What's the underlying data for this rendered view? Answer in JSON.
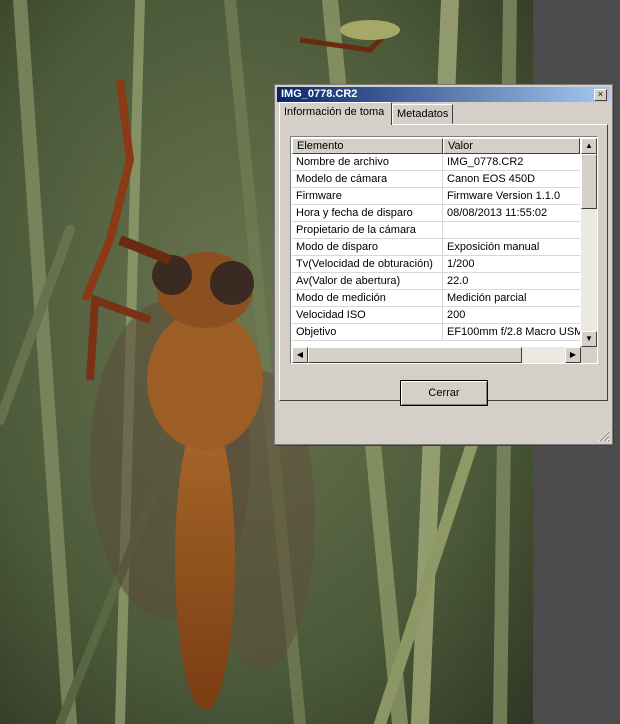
{
  "background": {
    "photo": "macro photograph of an orange robber fly on green pine needles",
    "icon": "robber-fly-photo"
  },
  "dialog": {
    "title": "IMG_0778.CR2",
    "close_glyph": "×",
    "tabs": [
      {
        "label": "Información de toma",
        "active": true
      },
      {
        "label": "Metadatos",
        "active": false
      }
    ],
    "table": {
      "headers": [
        "Elemento",
        "Valor"
      ],
      "rows": [
        {
          "element": "Nombre de archivo",
          "value": "IMG_0778.CR2"
        },
        {
          "element": "Modelo de cámara",
          "value": "Canon EOS 450D"
        },
        {
          "element": "Firmware",
          "value": "Firmware Version 1.1.0"
        },
        {
          "element": "Hora y fecha de disparo",
          "value": "08/08/2013 11:55:02"
        },
        {
          "element": "Propietario de la cámara",
          "value": ""
        },
        {
          "element": "Modo de disparo",
          "value": "Exposición manual"
        },
        {
          "element": "Tv(Velocidad de obturación)",
          "value": "1/200"
        },
        {
          "element": "Av(Valor de abertura)",
          "value": "22.0"
        },
        {
          "element": "Modo de medición",
          "value": "Medición parcial"
        },
        {
          "element": "Velocidad ISO",
          "value": "200"
        },
        {
          "element": "Objetivo",
          "value": "EF100mm f/2.8 Macro USM"
        }
      ]
    },
    "close_button": "Cerrar"
  },
  "colors": {
    "titlebar_start": "#0a246a",
    "titlebar_end": "#a6caf0",
    "dialog_face": "#d4d0c8"
  }
}
